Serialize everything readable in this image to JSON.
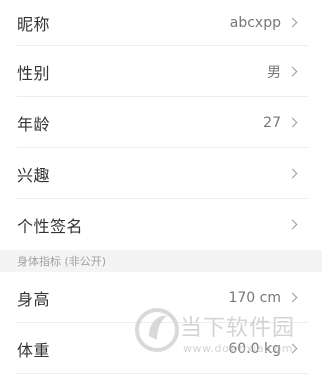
{
  "profile_rows": [
    {
      "label": "昵称",
      "value": "abcxpp"
    },
    {
      "label": "性别",
      "value": "男"
    },
    {
      "label": "年龄",
      "value": "27"
    },
    {
      "label": "兴趣",
      "value": ""
    },
    {
      "label": "个性签名",
      "value": ""
    }
  ],
  "body_section": {
    "header": "身体指标 (非公开)",
    "rows": [
      {
        "label": "身高",
        "value": "170 cm"
      },
      {
        "label": "体重",
        "value": "60.0 kg"
      }
    ]
  },
  "watermark": {
    "brand": "当下软件园",
    "url": "www.downxia.com"
  },
  "colors": {
    "label": "#333333",
    "value": "#777777",
    "divider": "#ececec",
    "section_bg": "#f4f4f4",
    "section_text": "#a0a0a0"
  }
}
